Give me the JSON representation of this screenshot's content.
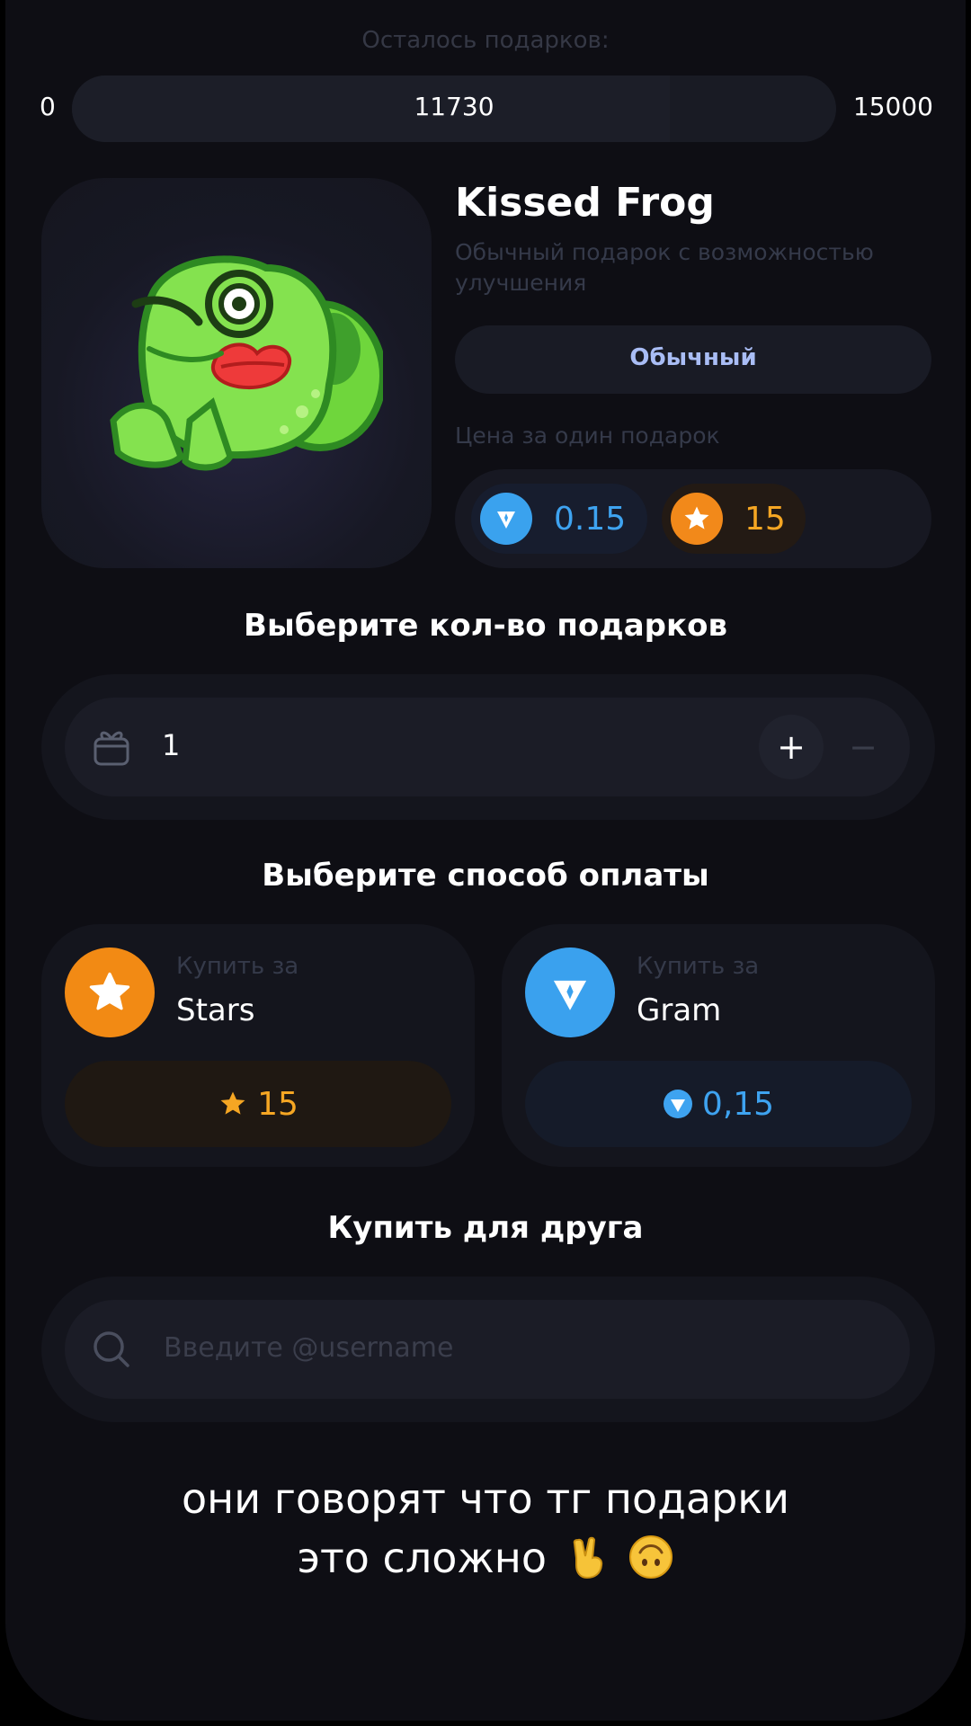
{
  "remaining": {
    "title": "Осталось подарков:",
    "min": "0",
    "max": "15000",
    "current": "11730",
    "fraction": 0.782
  },
  "gift": {
    "name": "Kissed Frog",
    "description": "Обычный подарок с возможностью улучшения",
    "rarity": "Обычный",
    "price_label": "Цена за один подарок",
    "price_ton": "0.15",
    "price_stars": "15"
  },
  "quantity": {
    "title": "Выберите кол-во подарков",
    "value": "1",
    "plus": "+",
    "minus": "−"
  },
  "payment": {
    "title": "Выберите способ оплаты",
    "stars": {
      "sub": "Купить за",
      "name": "Stars",
      "amount": "15"
    },
    "gram": {
      "sub": "Купить за",
      "name": "Gram",
      "amount": "0,15"
    }
  },
  "friend": {
    "title": "Купить для друга",
    "placeholder": "Введите @username"
  },
  "caption": {
    "line1": "они говорят что тг подарки",
    "line2": "это сложно"
  },
  "colors": {
    "background": "#0e0e14",
    "card": "#14151d",
    "ton_blue": "#3aa2ee",
    "star_orange": "#f2891a",
    "rarity_text": "#a9bdf5",
    "frog_green": "#7ee04a"
  },
  "icons": [
    "gift-icon",
    "search-icon",
    "star-icon",
    "diamond-icon",
    "victory-hand-emoji",
    "upside-down-face-emoji"
  ]
}
